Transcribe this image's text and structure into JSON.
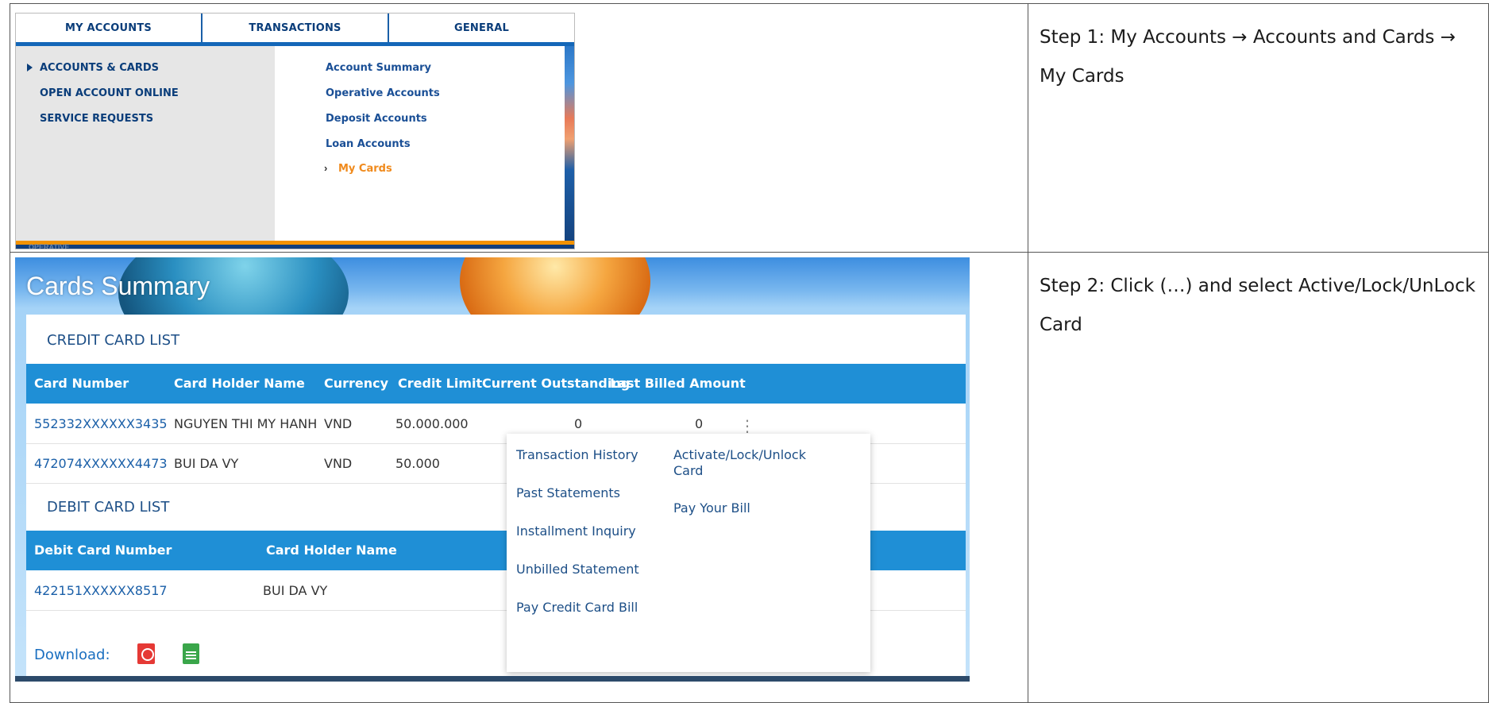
{
  "nav": {
    "tabs": [
      "MY ACCOUNTS",
      "TRANSACTIONS",
      "GENERAL"
    ],
    "left_menu": [
      "ACCOUNTS & CARDS",
      "OPEN ACCOUNT ONLINE",
      "SERVICE REQUESTS"
    ],
    "right_menu": [
      "Account Summary",
      "Operative Accounts",
      "Deposit Accounts",
      "Loan Accounts",
      "My Cards"
    ],
    "chevron": "›",
    "under_label": "OPERATIVE"
  },
  "steps": {
    "step1": {
      "label": "Step 1",
      "text": ": My Accounts → Accounts and Cards → My Cards"
    },
    "step2": {
      "label": "Step 2",
      "text": ": Click  (…) and select Active/Lock/UnLock Card"
    }
  },
  "cards": {
    "title": "Cards Summary",
    "credit": {
      "title": "CREDIT CARD LIST",
      "headers": [
        "Card Number",
        "Card Holder Name",
        "Currency",
        "Credit Limit",
        "Current Outstanding",
        "Last Billed Amount"
      ],
      "rows": [
        [
          "552332XXXXXX3435",
          "NGUYEN THI MY HANH",
          "VND",
          "50.000.000",
          "0",
          "0"
        ],
        [
          "472074XXXXXX4473",
          "BUI DA VY",
          "VND",
          "50.000"
        ]
      ]
    },
    "debit": {
      "title": "DEBIT CARD LIST",
      "headers": [
        "Debit Card Number",
        "Card Holder Name"
      ],
      "rows": [
        [
          "422151XXXXXX8517",
          "BUI DA VY"
        ]
      ]
    },
    "kebab": "⋮",
    "menu": {
      "left": [
        "Transaction History",
        "Past Statements",
        "Installment Inquiry",
        "Unbilled Statement",
        "Pay Credit Card Bill"
      ],
      "right": [
        "Activate/Lock/Unlock Card",
        "Pay Your Bill"
      ]
    },
    "download_label": "Download:",
    "icons": [
      "pdf-icon",
      "spreadsheet-icon"
    ]
  }
}
